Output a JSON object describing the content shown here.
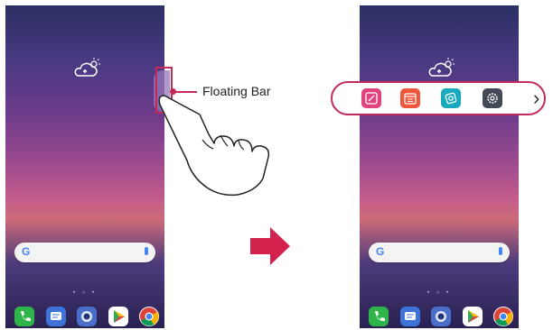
{
  "callout": {
    "label": "Floating Bar"
  },
  "phones": [
    {
      "id": "before",
      "page_dots": "• ○ •"
    },
    {
      "id": "after",
      "page_dots": "• ○ •"
    }
  ],
  "search": {
    "logo": "G"
  },
  "dock_apps": [
    "phone-icon",
    "messages-icon",
    "camera-icon",
    "play-store-icon",
    "chrome-icon"
  ],
  "floating_bar": {
    "items": [
      "memo-icon",
      "calendar-icon",
      "capture-icon",
      "settings-icon"
    ],
    "next_symbol": "›"
  },
  "colors": {
    "highlight": "#c42a5a",
    "arrow": "#d3224e"
  }
}
